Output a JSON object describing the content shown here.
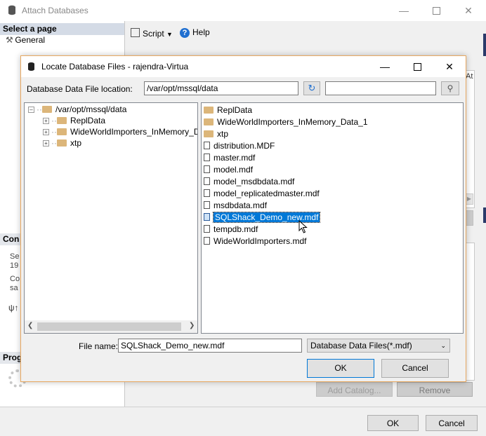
{
  "window": {
    "title": "Attach Databases",
    "select_page_header": "Select a page",
    "pages": [
      "General"
    ],
    "connection_header": "Con",
    "connection_lines": [
      "Se",
      "19",
      "Co",
      "sa"
    ],
    "progress_header": "Prog",
    "toolbar": {
      "script_label": "Script",
      "help_label": "Help"
    },
    "right_edge_fragment": "At",
    "add_catalog_label": "Add Catalog...",
    "remove_label": "Remove",
    "ok_label": "OK",
    "cancel_label": "Cancel"
  },
  "dialog": {
    "title": "Locate Database Files - rajendra-Virtua",
    "location_label": "Database Data File location:",
    "location_value": "/var/opt/mssql/data",
    "search_value": "",
    "tree": {
      "root": "/var/opt/mssql/data",
      "children": [
        "ReplData",
        "WideWorldImporters_InMemory_Data_",
        "xtp"
      ]
    },
    "files": [
      {
        "name": "ReplData",
        "kind": "folder"
      },
      {
        "name": "WideWorldImporters_InMemory_Data_1",
        "kind": "folder"
      },
      {
        "name": "xtp",
        "kind": "folder"
      },
      {
        "name": "distribution.MDF",
        "kind": "file"
      },
      {
        "name": "master.mdf",
        "kind": "file"
      },
      {
        "name": "model.mdf",
        "kind": "file"
      },
      {
        "name": "model_msdbdata.mdf",
        "kind": "file"
      },
      {
        "name": "model_replicatedmaster.mdf",
        "kind": "file"
      },
      {
        "name": "msdbdata.mdf",
        "kind": "file"
      },
      {
        "name": "SQLShack_Demo_new.mdf",
        "kind": "file",
        "selected": true
      },
      {
        "name": "tempdb.mdf",
        "kind": "file"
      },
      {
        "name": "WideWorldImporters.mdf",
        "kind": "file"
      }
    ],
    "file_name_label": "File name:",
    "file_name_value": "SQLShack_Demo_new.mdf",
    "file_type_value": "Database Data Files(*.mdf)",
    "ok_label": "OK",
    "cancel_label": "Cancel"
  },
  "colors": {
    "accent": "#0078d7",
    "dialog_border": "#e8a860",
    "section_header": "#d4dbe6"
  }
}
